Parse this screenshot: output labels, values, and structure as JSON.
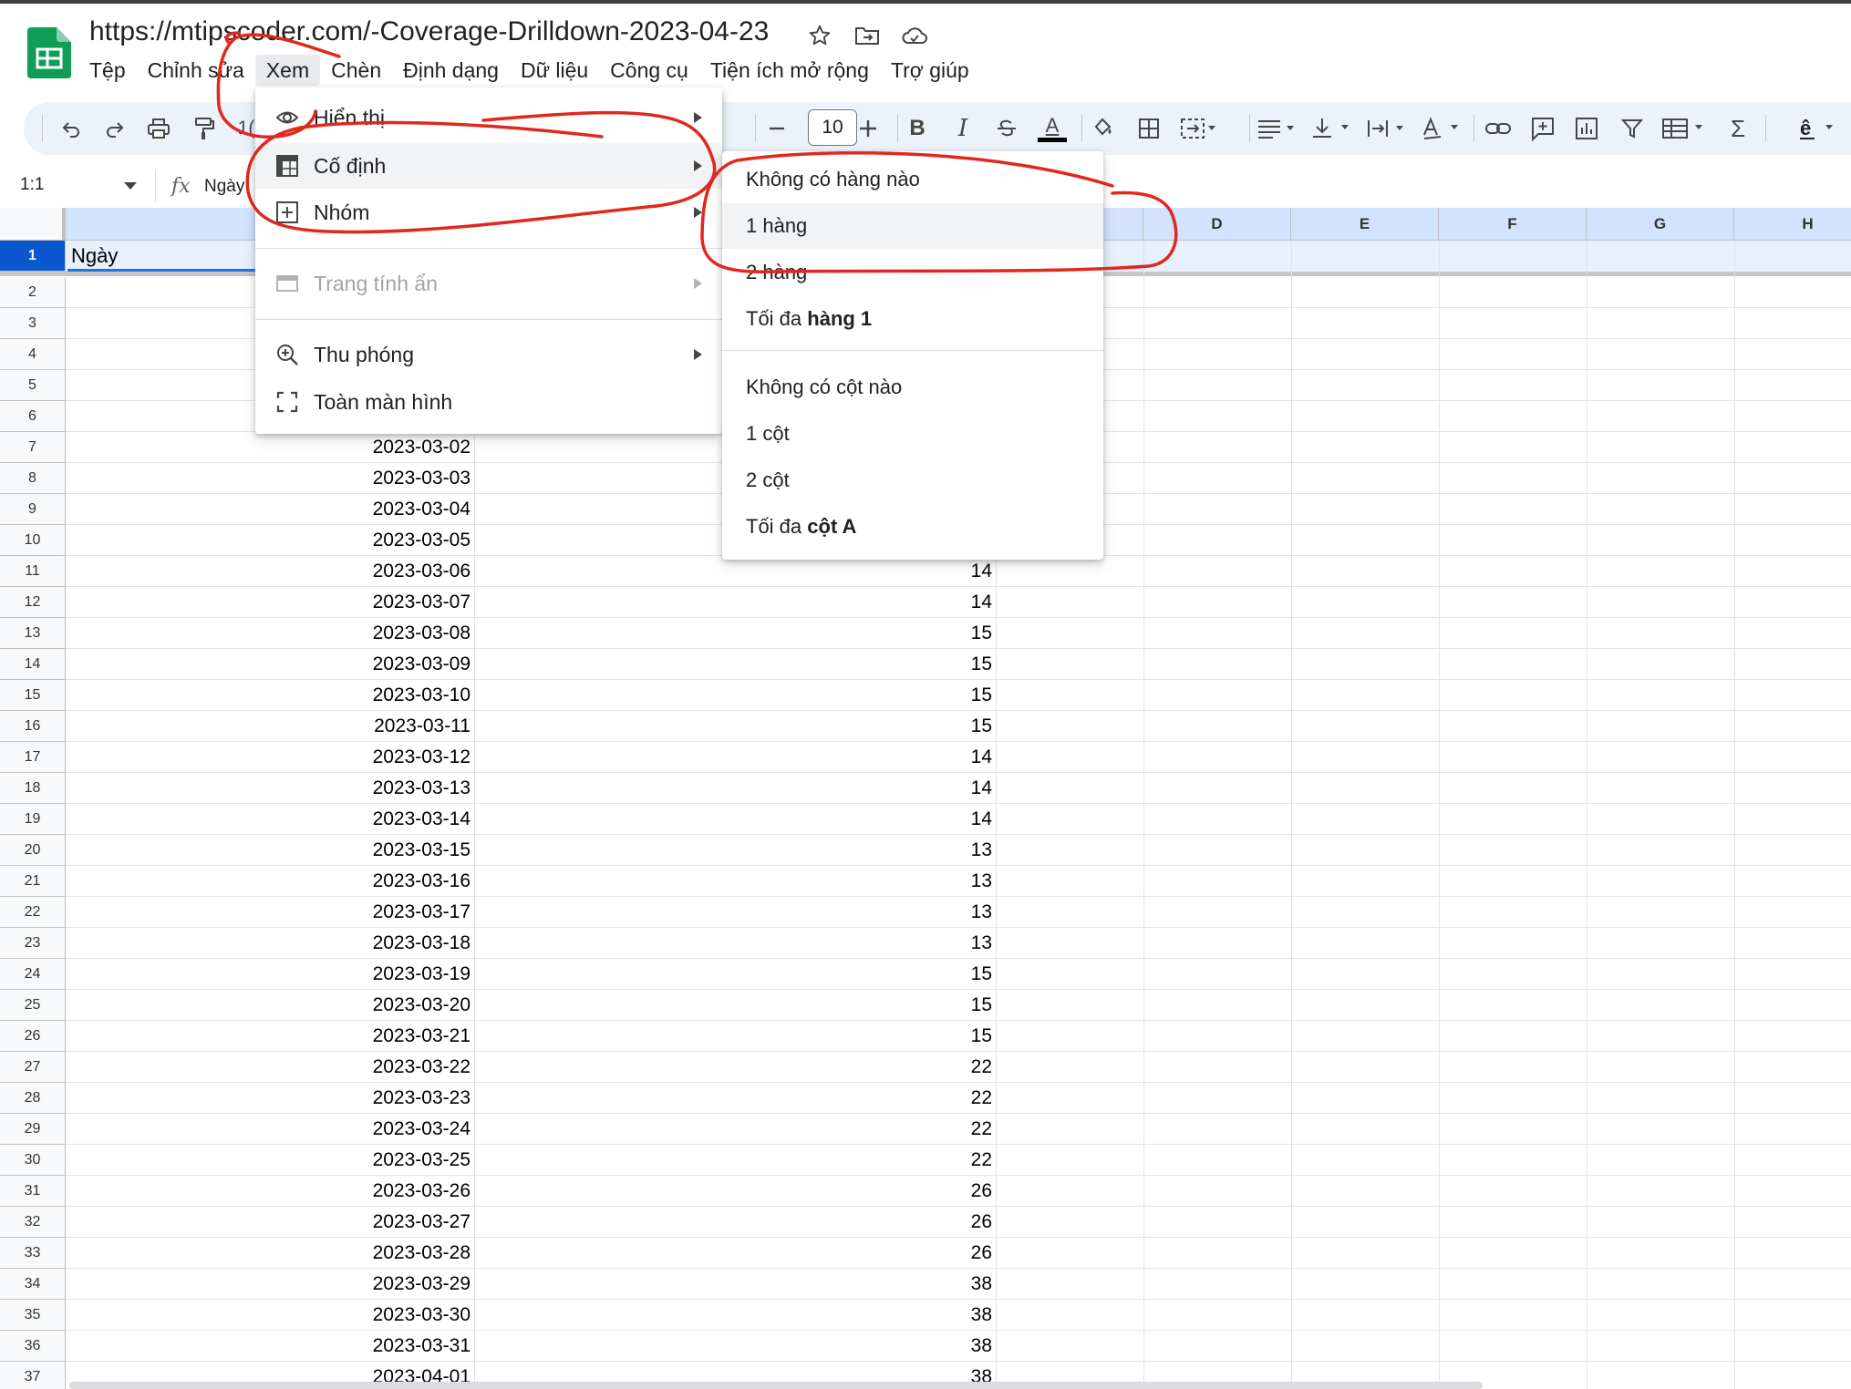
{
  "document": {
    "title": "https://mtipscoder.com/-Coverage-Drilldown-2023-04-23"
  },
  "menubar": {
    "items": [
      "Tệp",
      "Chỉnh sửa",
      "Xem",
      "Chèn",
      "Định dạng",
      "Dữ liệu",
      "Công cụ",
      "Tiện ích mở rộng",
      "Trợ giúp"
    ],
    "active": "Xem"
  },
  "toolbar": {
    "font_size": "10",
    "partial_zoom": "1("
  },
  "formula_bar": {
    "cell_ref": "1:1",
    "content": "Ngày"
  },
  "view_menu": {
    "items": [
      {
        "label": "Hiển thị",
        "icon": "eye-icon",
        "submenu": true
      },
      {
        "label": "Cố định",
        "icon": "freeze-icon",
        "submenu": true
      },
      {
        "label": "Nhóm",
        "icon": "group-icon",
        "submenu": true
      },
      {
        "label": "Trang tính ẩn",
        "icon": "hidden-sheet-icon",
        "submenu": true,
        "disabled": true
      },
      {
        "label": "Thu phóng",
        "icon": "zoom-icon",
        "submenu": true
      },
      {
        "label": "Toàn màn hình",
        "icon": "fullscreen-icon",
        "submenu": false
      }
    ]
  },
  "freeze_submenu": {
    "items": [
      {
        "label": "Không có hàng nào"
      },
      {
        "label": "1 hàng"
      },
      {
        "label": "2 hàng"
      },
      {
        "label_prefix": "Tối đa ",
        "label_bold": "hàng 1"
      },
      {
        "label": "Không có cột nào"
      },
      {
        "label": "1 cột"
      },
      {
        "label": "2 cột"
      },
      {
        "label_prefix": "Tối đa ",
        "label_bold": "cột A"
      }
    ]
  },
  "sheet": {
    "columns": [
      "D",
      "E",
      "F",
      "G",
      "H"
    ],
    "header_cell": "Ngày",
    "row_numbers": [
      "1",
      "2",
      "3",
      "4",
      "5",
      "6",
      "7",
      "8",
      "9",
      "10",
      "11",
      "12",
      "13",
      "14",
      "15",
      "16",
      "17",
      "18",
      "19",
      "20",
      "21",
      "22",
      "23",
      "24",
      "25",
      "26",
      "27",
      "28",
      "29",
      "30",
      "31",
      "32",
      "33",
      "34",
      "35",
      "36",
      "37"
    ],
    "rows": [
      {
        "row": 7,
        "date": "2023-03-02",
        "value": ""
      },
      {
        "row": 8,
        "date": "2023-03-03",
        "value": ""
      },
      {
        "row": 9,
        "date": "2023-03-04",
        "value": ""
      },
      {
        "row": 10,
        "date": "2023-03-05",
        "value": ""
      },
      {
        "row": 11,
        "date": "2023-03-06",
        "value": "14"
      },
      {
        "row": 12,
        "date": "2023-03-07",
        "value": "14"
      },
      {
        "row": 13,
        "date": "2023-03-08",
        "value": "15"
      },
      {
        "row": 14,
        "date": "2023-03-09",
        "value": "15"
      },
      {
        "row": 15,
        "date": "2023-03-10",
        "value": "15"
      },
      {
        "row": 16,
        "date": "2023-03-11",
        "value": "15"
      },
      {
        "row": 17,
        "date": "2023-03-12",
        "value": "14"
      },
      {
        "row": 18,
        "date": "2023-03-13",
        "value": "14"
      },
      {
        "row": 19,
        "date": "2023-03-14",
        "value": "14"
      },
      {
        "row": 20,
        "date": "2023-03-15",
        "value": "13"
      },
      {
        "row": 21,
        "date": "2023-03-16",
        "value": "13"
      },
      {
        "row": 22,
        "date": "2023-03-17",
        "value": "13"
      },
      {
        "row": 23,
        "date": "2023-03-18",
        "value": "13"
      },
      {
        "row": 24,
        "date": "2023-03-19",
        "value": "15"
      },
      {
        "row": 25,
        "date": "2023-03-20",
        "value": "15"
      },
      {
        "row": 26,
        "date": "2023-03-21",
        "value": "15"
      },
      {
        "row": 27,
        "date": "2023-03-22",
        "value": "22"
      },
      {
        "row": 28,
        "date": "2023-03-23",
        "value": "22"
      },
      {
        "row": 29,
        "date": "2023-03-24",
        "value": "22"
      },
      {
        "row": 30,
        "date": "2023-03-25",
        "value": "22"
      },
      {
        "row": 31,
        "date": "2023-03-26",
        "value": "26"
      },
      {
        "row": 32,
        "date": "2023-03-27",
        "value": "26"
      },
      {
        "row": 33,
        "date": "2023-03-28",
        "value": "26"
      },
      {
        "row": 34,
        "date": "2023-03-29",
        "value": "38"
      },
      {
        "row": 35,
        "date": "2023-03-30",
        "value": "38"
      },
      {
        "row": 36,
        "date": "2023-03-31",
        "value": "38"
      },
      {
        "row": 37,
        "date": "2023-04-01",
        "value": "38"
      }
    ]
  },
  "colors": {
    "accent": "#0b57d0",
    "annotation": "#e0281e",
    "toolbar_bg": "#edf2fa",
    "col_header_selected": "#d3e3fd",
    "sheets_green": "#0f9d58"
  }
}
